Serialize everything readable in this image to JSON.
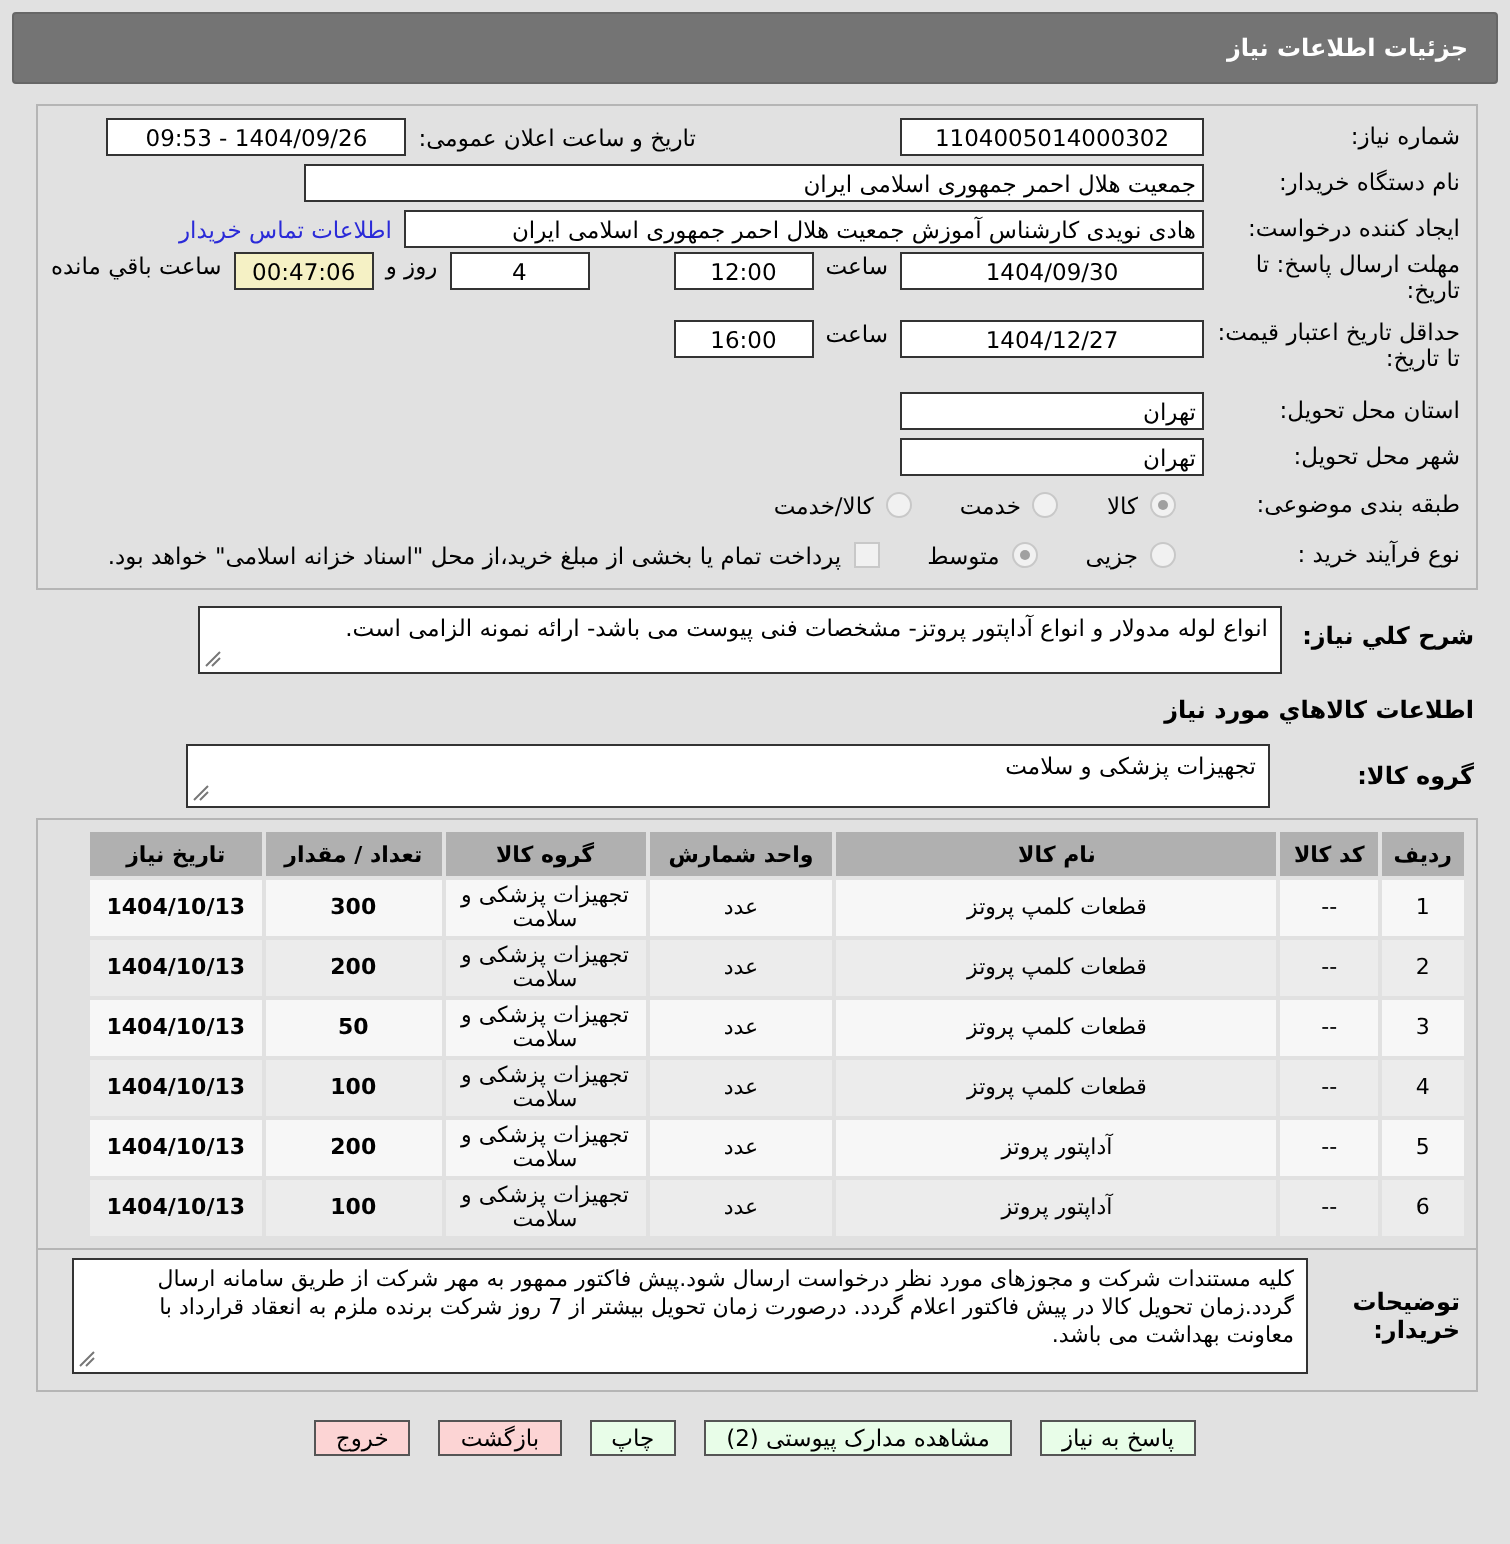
{
  "header": {
    "title": "جزئیات اطلاعات نیاز"
  },
  "form": {
    "need_number_label": "شماره نیاز:",
    "need_number": "1104005014000302",
    "announce_label": "تاریخ و ساعت اعلان عمومی:",
    "announce_value": "1404/09/26 - 09:53",
    "buyer_label": "نام دستگاه خریدار:",
    "buyer": "جمعیت هلال احمر جمهوری اسلامی ایران",
    "creator_label": "ایجاد کننده درخواست:",
    "creator": "هادی نویدی کارشناس آموزش جمعیت هلال احمر جمهوری اسلامی ایران",
    "contact_link": "اطلاعات تماس خریدار",
    "deadline_label": "مهلت ارسال پاسخ: تا تاریخ:",
    "deadline_date": "1404/09/30",
    "time_label": "ساعت",
    "deadline_time": "12:00",
    "days": "4",
    "days_label": "روز و",
    "remaining": "00:47:06",
    "remaining_label": "ساعت باقي مانده",
    "validity_label": "حداقل تاریخ اعتبار قیمت: تا تاریخ:",
    "validity_date": "1404/12/27",
    "validity_time_label": "ساعت",
    "validity_time": "16:00",
    "province_label": "استان محل تحویل:",
    "province": "تهران",
    "city_label": "شهر محل تحویل:",
    "city": "تهران",
    "category_label": "طبقه بندی موضوعی:",
    "category_options": [
      {
        "label": "کالا",
        "selected": true
      },
      {
        "label": "خدمت",
        "selected": false
      },
      {
        "label": "کالا/خدمت",
        "selected": false
      }
    ],
    "process_label": "نوع فرآیند خرید :",
    "process_options": [
      {
        "label": "جزیی",
        "selected": false
      },
      {
        "label": "متوسط",
        "selected": true
      }
    ],
    "treasury": {
      "checked": false,
      "label": "پرداخت تمام یا بخشی از مبلغ خرید،از محل \"اسناد خزانه اسلامی\" خواهد بود."
    }
  },
  "summary": {
    "label": "شرح کلي نیاز:",
    "value": "انواع لوله مدولار و انواع آداپتور پروتز- مشخصات فنی پیوست می باشد- ارائه نمونه الزامی است."
  },
  "goods_title": "اطلاعات كالاهاي مورد نیاز",
  "group": {
    "label": "گروه کالا:",
    "value": "تجهیزات پزشکی و سلامت"
  },
  "table": {
    "columns": [
      "ردیف",
      "کد کالا",
      "نام کالا",
      "واحد شمارش",
      "گروه کالا",
      "تعداد / مقدار",
      "تاریخ نیاز"
    ],
    "rows": [
      [
        "1",
        "--",
        "قطعات کلمپ پروتز",
        "عدد",
        "تجهیزات پزشکی و سلامت",
        "300",
        "1404/10/13"
      ],
      [
        "2",
        "--",
        "قطعات کلمپ پروتز",
        "عدد",
        "تجهیزات پزشکی و سلامت",
        "200",
        "1404/10/13"
      ],
      [
        "3",
        "--",
        "قطعات کلمپ پروتز",
        "عدد",
        "تجهیزات پزشکی و سلامت",
        "50",
        "1404/10/13"
      ],
      [
        "4",
        "--",
        "قطعات کلمپ پروتز",
        "عدد",
        "تجهیزات پزشکی و سلامت",
        "100",
        "1404/10/13"
      ],
      [
        "5",
        "--",
        "آداپتور پروتز",
        "عدد",
        "تجهیزات پزشکی و سلامت",
        "200",
        "1404/10/13"
      ],
      [
        "6",
        "--",
        "آداپتور پروتز",
        "عدد",
        "تجهیزات پزشکی و سلامت",
        "100",
        "1404/10/13"
      ]
    ]
  },
  "notes": {
    "label": "توضیحات خریدار:",
    "value": "کلیه مستندات شرکت و مجوزهای مورد نظر درخواست ارسال شود.پیش فاکتور ممهور به مهر شرکت از طریق سامانه ارسال گردد.زمان تحویل کالا در پیش فاکتور اعلام گردد. درصورت زمان تحویل بیشتر از 7 روز شرکت برنده ملزم به انعقاد قرارداد با معاونت بهداشت می باشد."
  },
  "buttons": [
    {
      "label": "پاسخ به نیاز",
      "kind": "primary"
    },
    {
      "label": "مشاهده مدارک پیوستی (2)",
      "kind": "primary"
    },
    {
      "label": "چاپ",
      "kind": "primary"
    },
    {
      "label": "بازگشت",
      "kind": "danger"
    },
    {
      "label": "خروج",
      "kind": "danger"
    }
  ]
}
